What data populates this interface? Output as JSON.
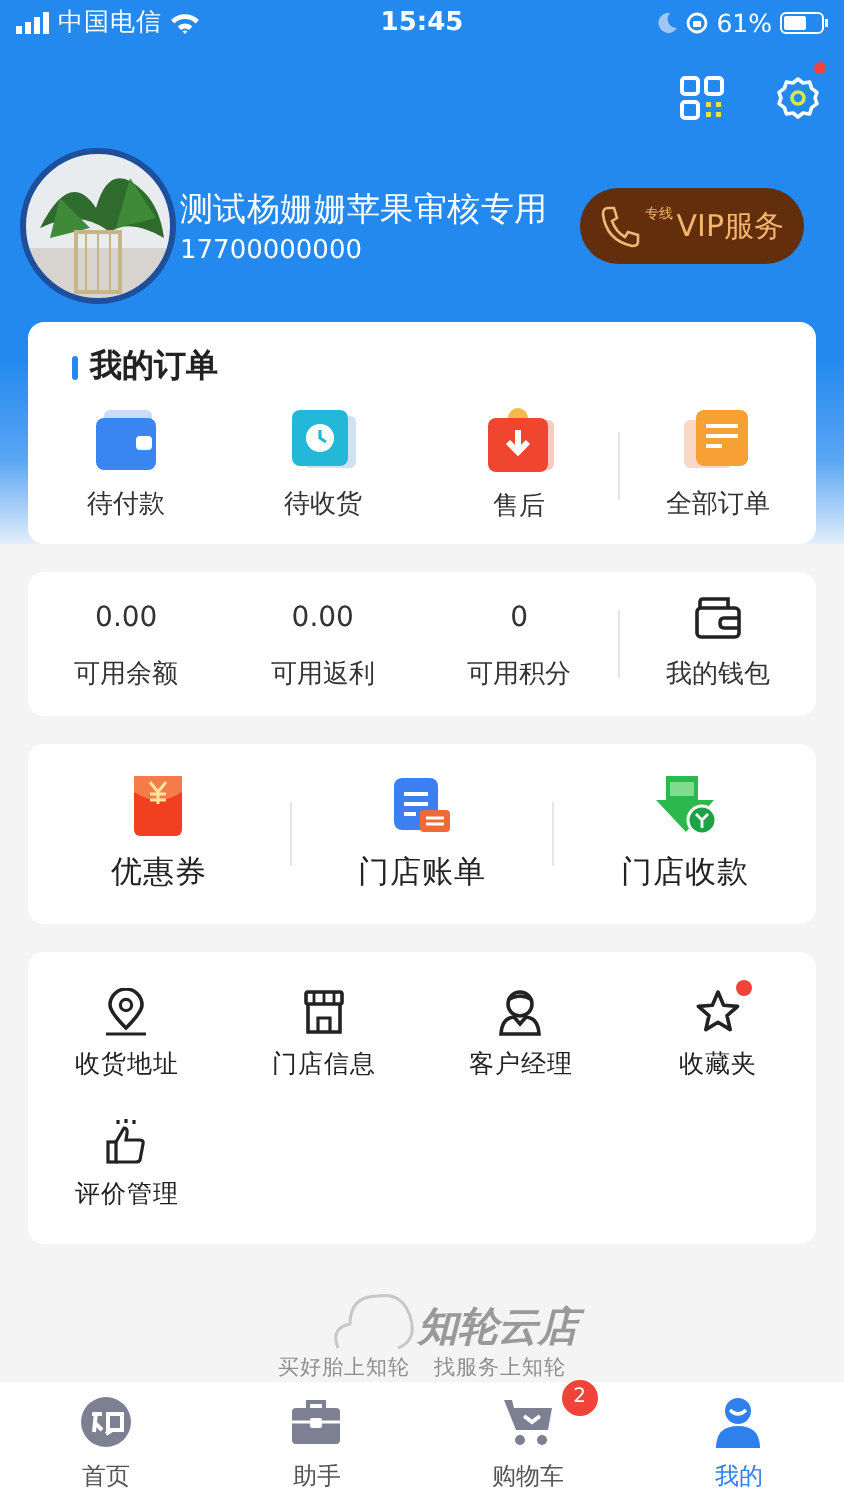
{
  "status_bar": {
    "carrier": "中国电信",
    "time": "15:45",
    "battery": "61%"
  },
  "header": {
    "settings_dot": true
  },
  "profile": {
    "name": "测试杨姗姗苹果审核专用",
    "phone": "17700000000",
    "vip_button": {
      "tag": "专线",
      "label": "VIP服务"
    }
  },
  "orders": {
    "title": "我的订单",
    "items": [
      {
        "label": "待付款",
        "kind": "wallet"
      },
      {
        "label": "待收货",
        "kind": "clock"
      },
      {
        "label": "售后",
        "kind": "refund"
      },
      {
        "label": "全部订单",
        "kind": "list"
      }
    ]
  },
  "wallet": {
    "items": [
      {
        "value": "0.00",
        "label": "可用余额"
      },
      {
        "value": "0.00",
        "label": "可用返利"
      },
      {
        "value": "0",
        "label": "可用积分"
      }
    ],
    "link": "我的钱包"
  },
  "shortcuts": [
    {
      "label": "优惠券",
      "kind": "coupon"
    },
    {
      "label": "门店账单",
      "kind": "bill"
    },
    {
      "label": "门店收款",
      "kind": "collect"
    }
  ],
  "services": [
    {
      "label": "收货地址",
      "kind": "pin",
      "dot": false
    },
    {
      "label": "门店信息",
      "kind": "store",
      "dot": false
    },
    {
      "label": "客户经理",
      "kind": "person",
      "dot": false
    },
    {
      "label": "收藏夹",
      "kind": "star",
      "dot": true
    },
    {
      "label": "评价管理",
      "kind": "thumb",
      "dot": false
    }
  ],
  "footer": {
    "brand": "知轮云店",
    "slogan_1": "买好胎上知轮",
    "slogan_2": "找服务上知轮"
  },
  "tab_bar": [
    {
      "label": "首页",
      "kind": "home",
      "selected": false
    },
    {
      "label": "助手",
      "kind": "case",
      "selected": false
    },
    {
      "label": "购物车",
      "kind": "cart",
      "selected": false,
      "badge": "2"
    },
    {
      "label": "我的",
      "kind": "me",
      "selected": true
    }
  ]
}
